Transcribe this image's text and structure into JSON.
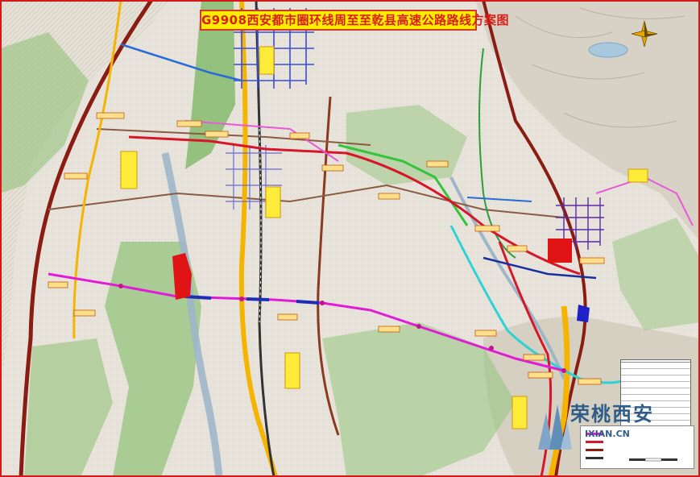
{
  "map": {
    "title": "G9908西安都市圈环线周至至乾县高速公路路线方案图",
    "watermark_text": "荣桃西安",
    "watermark_url": "IXIAN.CN",
    "colors": {
      "terrain": "#d9d3c7",
      "farmland": "#e7e3da",
      "green_area": "#7fb86a",
      "planned_route": "#e11bd8",
      "railway": "#333333",
      "expressway": "#f5b400",
      "national_road": "#8b1c12",
      "river": "#9fb6c9",
      "title_bg": "#ffec00",
      "title_text": "#d81f16"
    },
    "icons": [
      "compass-rose-icon"
    ]
  }
}
